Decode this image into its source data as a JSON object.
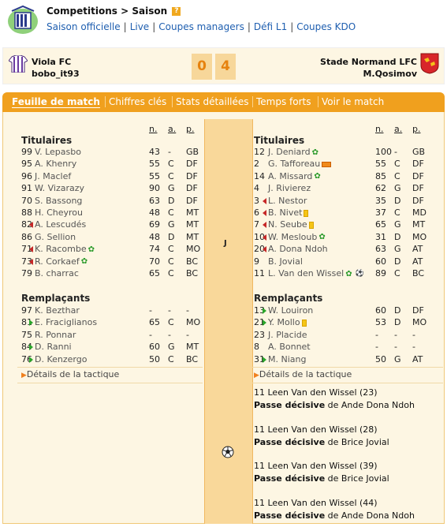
{
  "header": {
    "crumb_competitions": "Competitions",
    "crumb_sep": ">",
    "crumb_saison": "Saison",
    "help": "?",
    "nav": [
      "Saison officielle",
      "Live",
      "Coupes managers",
      "Défi L1",
      "Coupes KDO"
    ]
  },
  "match": {
    "home_team": "Viola FC",
    "home_manager": "bobo_it93",
    "away_team": "Stade Normand LFC",
    "away_manager": "M.Qosimov",
    "home_score": "0",
    "away_score": "4"
  },
  "tabs": [
    "Feuille de match",
    "Chiffres clés",
    "Stats détaillées",
    "Temps forts",
    "Voir le match"
  ],
  "columns": {
    "n": "n.",
    "a": "a.",
    "p": "p."
  },
  "sections": {
    "starters": "Titulaires",
    "subs": "Remplaçants",
    "tactics": "Détails de la tactique"
  },
  "center_label": "J",
  "home_starters": [
    {
      "num": "99",
      "name": "V. Lepasbo",
      "n": "43",
      "a": "-",
      "p": "GB",
      "icons": []
    },
    {
      "num": "95",
      "name": "A. Khenry",
      "n": "55",
      "a": "C",
      "p": "DF",
      "icons": []
    },
    {
      "num": "96",
      "name": "J. Maclef",
      "n": "55",
      "a": "C",
      "p": "DF",
      "icons": []
    },
    {
      "num": "91",
      "name": "W. Vizarazy",
      "n": "90",
      "a": "G",
      "p": "DF",
      "icons": []
    },
    {
      "num": "70",
      "name": "S. Bassong",
      "n": "63",
      "a": "D",
      "p": "DF",
      "icons": []
    },
    {
      "num": "88",
      "name": "H. Cheyrou",
      "n": "48",
      "a": "C",
      "p": "MT",
      "icons": []
    },
    {
      "num": "82",
      "name": "A. Lescudés",
      "n": "69",
      "a": "G",
      "p": "MT",
      "icons": [
        "out"
      ]
    },
    {
      "num": "86",
      "name": "G. Sellion",
      "n": "48",
      "a": "D",
      "p": "MT",
      "icons": []
    },
    {
      "num": "71",
      "name": "K. Racombe",
      "n": "74",
      "a": "C",
      "p": "MO",
      "icons": [
        "out",
        "star"
      ]
    },
    {
      "num": "73",
      "name": "R. Corkaef",
      "n": "70",
      "a": "C",
      "p": "BC",
      "icons": [
        "out",
        "star"
      ]
    },
    {
      "num": "79",
      "name": "B. charrac",
      "n": "65",
      "a": "C",
      "p": "BC",
      "icons": []
    }
  ],
  "home_subs": [
    {
      "num": "97",
      "name": "K. Bezthar",
      "n": "-",
      "a": "-",
      "p": "-",
      "icons": []
    },
    {
      "num": "81",
      "name": "E. Fraciglianos",
      "n": "65",
      "a": "C",
      "p": "MO",
      "icons": [
        "in"
      ]
    },
    {
      "num": "75",
      "name": "R. Ponnar",
      "n": "-",
      "a": "-",
      "p": "-",
      "icons": []
    },
    {
      "num": "84",
      "name": "D. Ranni",
      "n": "60",
      "a": "G",
      "p": "MT",
      "icons": [
        "in"
      ]
    },
    {
      "num": "76",
      "name": "D. Kenzergo",
      "n": "50",
      "a": "C",
      "p": "BC",
      "icons": [
        "in"
      ]
    }
  ],
  "away_starters": [
    {
      "num": "12",
      "name": "J. Deniard",
      "n": "100",
      "a": "-",
      "p": "GB",
      "icons": [
        "star"
      ]
    },
    {
      "num": "2",
      "name": "G. Tafforeau",
      "n": "55",
      "a": "C",
      "p": "DF",
      "icons": [
        "card2"
      ]
    },
    {
      "num": "14",
      "name": "A. Missard",
      "n": "85",
      "a": "C",
      "p": "DF",
      "icons": [
        "star"
      ]
    },
    {
      "num": "4",
      "name": "J. Rivierez",
      "n": "62",
      "a": "G",
      "p": "DF",
      "icons": []
    },
    {
      "num": "3",
      "name": "L. Nestor",
      "n": "35",
      "a": "D",
      "p": "DF",
      "icons": [
        "out"
      ]
    },
    {
      "num": "6",
      "name": "B. Nivet",
      "n": "37",
      "a": "C",
      "p": "MD",
      "icons": [
        "out",
        "yellow"
      ]
    },
    {
      "num": "7",
      "name": "N. Seube",
      "n": "65",
      "a": "G",
      "p": "MT",
      "icons": [
        "out",
        "yellow"
      ]
    },
    {
      "num": "10",
      "name": "W. Mesloub",
      "n": "31",
      "a": "D",
      "p": "MO",
      "icons": [
        "out",
        "star"
      ]
    },
    {
      "num": "20",
      "name": "A. Dona Ndoh",
      "n": "63",
      "a": "G",
      "p": "AT",
      "icons": [
        "out"
      ]
    },
    {
      "num": "9",
      "name": "B. Jovial",
      "n": "60",
      "a": "D",
      "p": "AT",
      "icons": []
    },
    {
      "num": "11",
      "name": "L. Van den Wissel",
      "n": "89",
      "a": "C",
      "p": "BC",
      "icons": [
        "star",
        "ball"
      ]
    }
  ],
  "away_subs": [
    {
      "num": "13",
      "name": "W. Louiron",
      "n": "60",
      "a": "D",
      "p": "DF",
      "icons": [
        "in"
      ]
    },
    {
      "num": "21",
      "name": "Y. Mollo",
      "n": "53",
      "a": "D",
      "p": "MO",
      "icons": [
        "in",
        "yellow"
      ]
    },
    {
      "num": "23",
      "name": "J. Placide",
      "n": "-",
      "a": "-",
      "p": "-",
      "icons": []
    },
    {
      "num": "8",
      "name": "A. Bonnet",
      "n": "-",
      "a": "-",
      "p": "-",
      "icons": []
    },
    {
      "num": "31",
      "name": "M. Niang",
      "n": "50",
      "a": "G",
      "p": "AT",
      "icons": [
        "in"
      ]
    }
  ],
  "events": [
    {
      "line1": "11 Leen Van den Wissel (23)",
      "assist_label": "Passe décisive",
      "assist_rest": " de Ande Dona Ndoh"
    },
    {
      "line1": "11 Leen Van den Wissel (28)",
      "assist_label": "Passe décisive",
      "assist_rest": " de Brice Jovial"
    },
    {
      "line1": "11 Leen Van den Wissel (39)",
      "assist_label": "Passe décisive",
      "assist_rest": " de Brice Jovial"
    },
    {
      "line1": "11 Leen Van den Wissel (44)",
      "assist_label": "Passe décisive",
      "assist_rest": " de Ande Dona Ndoh"
    }
  ]
}
